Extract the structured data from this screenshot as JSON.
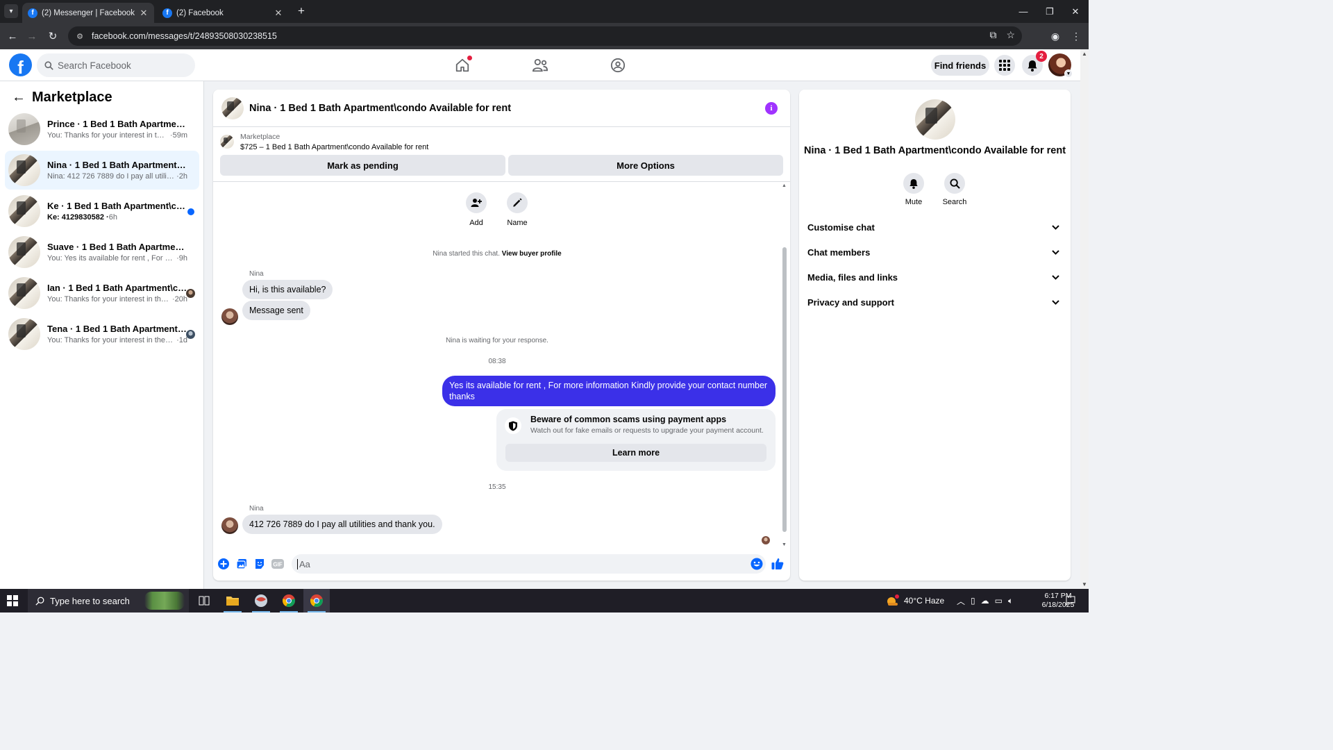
{
  "browser": {
    "tabs": [
      {
        "title": "(2) Messenger | Facebook",
        "active": true
      },
      {
        "title": "(2) Facebook",
        "active": false
      }
    ],
    "url": "facebook.com/messages/t/24893508030238515"
  },
  "header": {
    "search_placeholder": "Search Facebook",
    "find_friends": "Find friends",
    "notification_count": "2",
    "colors": {
      "brand": "#1877f2",
      "badge": "#e41e3f"
    }
  },
  "left_panel": {
    "title": "Marketplace",
    "conversations": [
      {
        "name": "Prince · 1 Bed 1 Bath Apartment\\condo Available for rent",
        "snippet": "You: Thanks for your interest in the apartment",
        "time": "59m",
        "unread": false
      },
      {
        "name": "Nina · 1 Bed 1 Bath Apartment\\condo Available for rent",
        "snippet": "Nina: 412 726 7889 do I pay all utilities and thank you.",
        "time": "2h",
        "unread": false,
        "selected": true
      },
      {
        "name": "Ke · 1 Bed 1 Bath Apartment\\condo Available for rent",
        "snippet": "Ke: 4129830582",
        "time": "6h",
        "unread": true
      },
      {
        "name": "Suave · 1 Bed 1 Bath Apartment\\condo Available for rent",
        "snippet": "You: Yes its available for rent , For more information",
        "time": "9h",
        "unread": false
      },
      {
        "name": "Ian · 1 Bed 1 Bath Apartment\\condo Available for rent",
        "snippet": "You: Thanks for your interest in the apartment",
        "time": "20h",
        "unread": false
      },
      {
        "name": "Tena · 1 Bed 1 Bath Apartment\\condo Available for rent",
        "snippet": "You: Thanks for your interest in the apartment",
        "time": "1d",
        "unread": false
      }
    ]
  },
  "chat": {
    "title": "Nina · 1 Bed 1 Bath Apartment\\condo Available for rent",
    "marketplace_label": "Marketplace",
    "listing": "$725 – 1 Bed 1 Bath Apartment\\condo Available for rent",
    "mark_pending": "Mark as pending",
    "more_options": "More Options",
    "quick_actions": {
      "add": "Add",
      "name": "Name"
    },
    "started_text": "Nina started this chat.",
    "view_profile": "View buyer profile",
    "sender": "Nina",
    "msg1": "Hi, is this available?",
    "msg2": "Message sent",
    "waiting": "Nina is waiting for your response.",
    "time1": "08:38",
    "outgoing": "Yes its  available for rent , For more information Kindly provide your contact number thanks",
    "scam_title": "Beware of common scams using payment apps",
    "scam_sub": "Watch out for fake emails or requests to upgrade your payment account.",
    "learn_more": "Learn more",
    "time2": "15:35",
    "sender2": "Nina",
    "msg3": "412 726 7889 do I pay all utilities and thank you.",
    "composer_placeholder": "Aa",
    "colors": {
      "outgoing": "#3b30e8",
      "accent": "#a033ff",
      "icons": "#0866ff"
    }
  },
  "info_panel": {
    "title": "Nina · 1 Bed 1 Bath Apartment\\condo Available for rent",
    "mute": "Mute",
    "search": "Search",
    "sections": [
      "Customise chat",
      "Chat members",
      "Media, files and links",
      "Privacy and support"
    ]
  },
  "taskbar": {
    "search_placeholder": "Type here to search",
    "weather": "40°C  Haze",
    "time": "6:17 PM",
    "date": "6/18/2025"
  }
}
